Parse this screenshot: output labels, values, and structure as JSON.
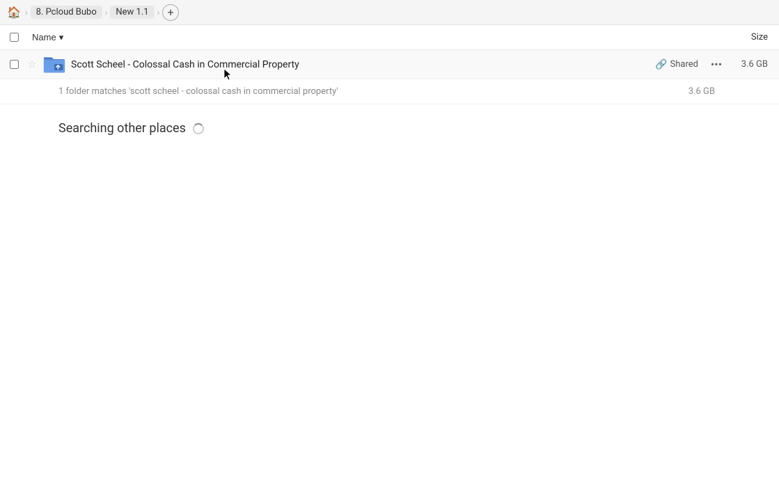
{
  "breadcrumb": {
    "home_icon": "🏠",
    "items": [
      {
        "label": "8. Pcloud Bubo"
      },
      {
        "label": "New 1.1"
      }
    ],
    "add_icon": "+",
    "separator": "›"
  },
  "column_header": {
    "name_label": "Name",
    "sort_icon": "▾",
    "size_label": "Size"
  },
  "file_row": {
    "name": "Scott Scheel - Colossal Cash in Commercial Property",
    "shared_label": "Shared",
    "size": "3.6 GB",
    "more_icon": "···"
  },
  "match_count": {
    "text": "1 folder matches 'scott scheel - colossal cash in commercial property'",
    "size": "3.6 GB"
  },
  "searching_section": {
    "text": "Searching other places"
  }
}
